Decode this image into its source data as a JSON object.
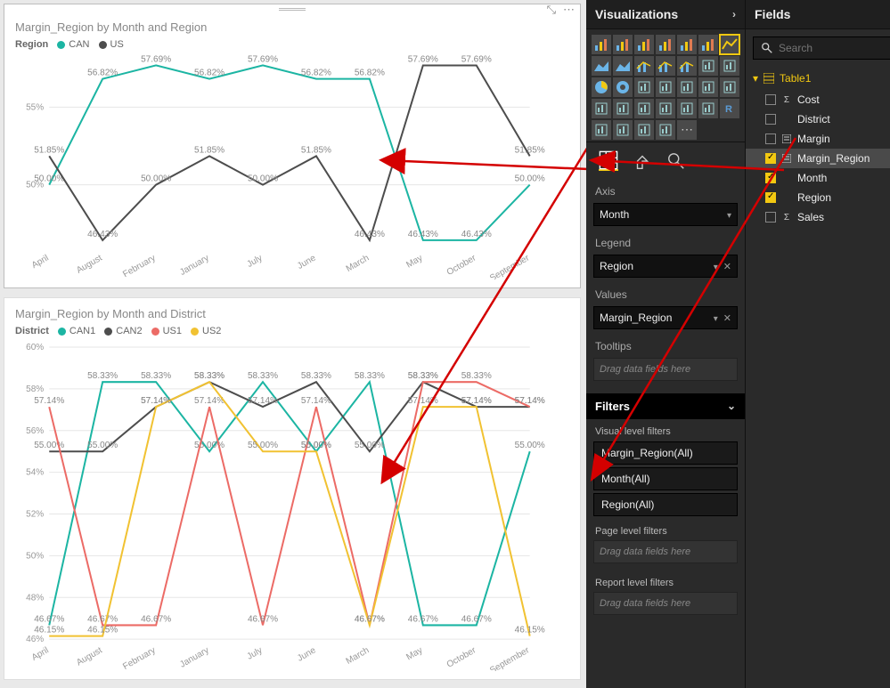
{
  "chart_data": [
    {
      "type": "line",
      "title": "Margin_Region by Month and Region",
      "legend_title": "Region",
      "ylabel": "%",
      "ylim": [
        46,
        58
      ],
      "yticks": [
        50,
        55
      ],
      "categories": [
        "April",
        "August",
        "February",
        "January",
        "July",
        "June",
        "March",
        "May",
        "October",
        "September"
      ],
      "series": [
        {
          "name": "CAN",
          "color": "#1cb5a3",
          "values": [
            50.0,
            56.82,
            57.69,
            56.82,
            57.69,
            56.82,
            56.82,
            46.43,
            46.43,
            50.0
          ]
        },
        {
          "name": "US",
          "color": "#4d4d4d",
          "values": [
            51.85,
            46.43,
            50.0,
            51.85,
            50.0,
            51.85,
            46.43,
            57.69,
            57.69,
            51.85
          ]
        }
      ]
    },
    {
      "type": "line",
      "title": "Margin_Region by Month and District",
      "legend_title": "District",
      "ylabel": "%",
      "ylim": [
        46,
        60
      ],
      "yticks": [
        46,
        48,
        50,
        52,
        54,
        56,
        58,
        60
      ],
      "categories": [
        "April",
        "August",
        "February",
        "January",
        "July",
        "June",
        "March",
        "May",
        "October",
        "September"
      ],
      "series": [
        {
          "name": "CAN1",
          "color": "#1cb5a3",
          "values": [
            46.67,
            58.33,
            58.33,
            55.0,
            58.33,
            55.0,
            58.33,
            46.67,
            46.67,
            55.0
          ]
        },
        {
          "name": "CAN2",
          "color": "#4d4d4d",
          "values": [
            55.0,
            55.0,
            57.14,
            58.33,
            57.14,
            58.33,
            55.0,
            58.33,
            57.14,
            57.14
          ]
        },
        {
          "name": "US1",
          "color": "#ec6b66",
          "values": [
            57.14,
            46.67,
            46.67,
            57.14,
            46.67,
            57.14,
            46.67,
            58.33,
            58.33,
            57.14
          ]
        },
        {
          "name": "US2",
          "color": "#f1c232",
          "values": [
            46.15,
            46.15,
            57.14,
            58.33,
            55.0,
            55.0,
            46.67,
            57.14,
            57.14,
            46.15
          ]
        }
      ]
    }
  ],
  "viz_pane": {
    "title": "Visualizations",
    "property_tabs": [
      "fields-tab",
      "format-tab",
      "analytics-tab"
    ],
    "sections": {
      "axis": {
        "label": "Axis",
        "value": "Month"
      },
      "legend": {
        "label": "Legend",
        "value": "Region"
      },
      "values": {
        "label": "Values",
        "value": "Margin_Region"
      },
      "tooltips": {
        "label": "Tooltips",
        "placeholder": "Drag data fields here"
      }
    },
    "filters": {
      "title": "Filters",
      "visual_label": "Visual level filters",
      "visual": [
        "Margin_Region(All)",
        "Month(All)",
        "Region(All)"
      ],
      "page_label": "Page level filters",
      "page_placeholder": "Drag data fields here",
      "report_label": "Report level filters",
      "report_placeholder": "Drag data fields here"
    }
  },
  "fields_pane": {
    "title": "Fields",
    "search_placeholder": "Search",
    "table": "Table1",
    "fields": [
      {
        "name": "Cost",
        "checked": false,
        "icon": "sigma"
      },
      {
        "name": "District",
        "checked": false,
        "icon": ""
      },
      {
        "name": "Margin",
        "checked": false,
        "icon": "calc"
      },
      {
        "name": "Margin_Region",
        "checked": true,
        "icon": "calc",
        "highlight": true
      },
      {
        "name": "Month",
        "checked": true,
        "icon": ""
      },
      {
        "name": "Region",
        "checked": true,
        "icon": ""
      },
      {
        "name": "Sales",
        "checked": false,
        "icon": "sigma"
      }
    ]
  },
  "chart_toolbar": {
    "expand": "⤡",
    "more": "⋯"
  }
}
